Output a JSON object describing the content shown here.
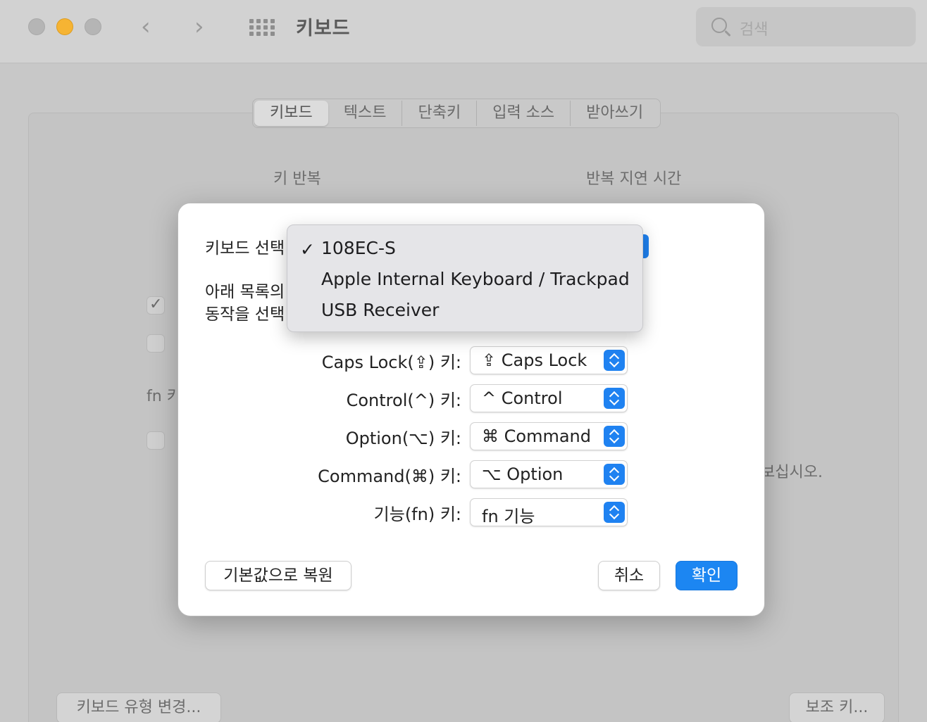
{
  "window": {
    "title": "키보드",
    "search_placeholder": "검색"
  },
  "tabs": [
    "키보드",
    "텍스트",
    "단축키",
    "입력 소스",
    "받아쓰기"
  ],
  "background": {
    "key_repeat_label": "키 반복",
    "repeat_delay_label": "반복 지연 시간",
    "fn_label_partial": "fn 키",
    "partial_text": "보십시오.",
    "change_keyboard_type_button": "키보드 유형 변경...",
    "modifier_keys_button": "보조 키..."
  },
  "sheet": {
    "keyboard_select_label": "키보드 선택",
    "instruction_line1": "아래 목록의",
    "instruction_line2": "동작을 선택",
    "rows": [
      {
        "label": "Caps Lock(⇪) 키:",
        "value": "⇪ Caps Lock"
      },
      {
        "label": "Control(^) 키:",
        "value": "^ Control"
      },
      {
        "label": "Option(⌥) 키:",
        "value": "⌘ Command"
      },
      {
        "label": "Command(⌘) 키:",
        "value": "⌥ Option"
      },
      {
        "label": "기능(fn) 키:",
        "value": "fn 기능"
      }
    ],
    "restore_defaults_button": "기본값으로 복원",
    "cancel_button": "취소",
    "ok_button": "확인"
  },
  "keyboard_menu": {
    "items": [
      "108EC-S",
      "Apple Internal Keyboard / Trackpad",
      "USB Receiver"
    ],
    "selected": "108EC-S"
  }
}
